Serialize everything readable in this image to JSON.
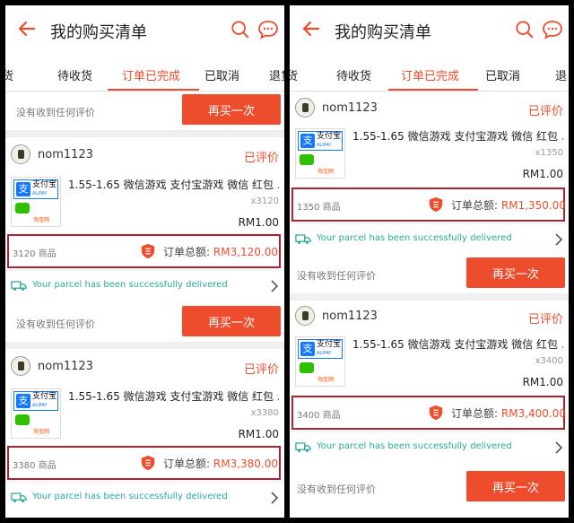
{
  "colors": {
    "accent": "#ee4d2d",
    "highlight_border": "#b21f2d",
    "delivered": "#26aa99"
  },
  "header": {
    "title": "我的购买清单"
  },
  "tabs_left": [
    "货",
    "待收货",
    "订单已完成",
    "已取消",
    "退货"
  ],
  "tabs_right": [
    "货",
    "待收货",
    "订单已完成",
    "已取消",
    "退"
  ],
  "common": {
    "no_review": "没有收到任何评价",
    "buy_again": "再买一次",
    "reviewed": "已评价",
    "shop_name": "nom1123",
    "product_name": "1.55-1.65 微信游戏 支付宝游戏 微信 红包 ...",
    "unit_price": "RM1.00",
    "items_suffix": "商品",
    "total_label": "订单总额:",
    "delivered": "Your parcel has been successfully delivered",
    "thumb": {
      "alipay": "支付宝",
      "alipay_en": "ALIPAY",
      "zhi": "支",
      "taobao": "淘宝网"
    }
  },
  "orders": [
    {
      "qty": "x3120",
      "count": "3120",
      "total": "RM3,120.00"
    },
    {
      "qty": "x3380",
      "count": "3380",
      "total": "RM3,380.00"
    },
    {
      "qty": "x1350",
      "count": "1350",
      "total": "RM1,350.00"
    },
    {
      "qty": "x3400",
      "count": "3400",
      "total": "RM3,400.00"
    }
  ]
}
